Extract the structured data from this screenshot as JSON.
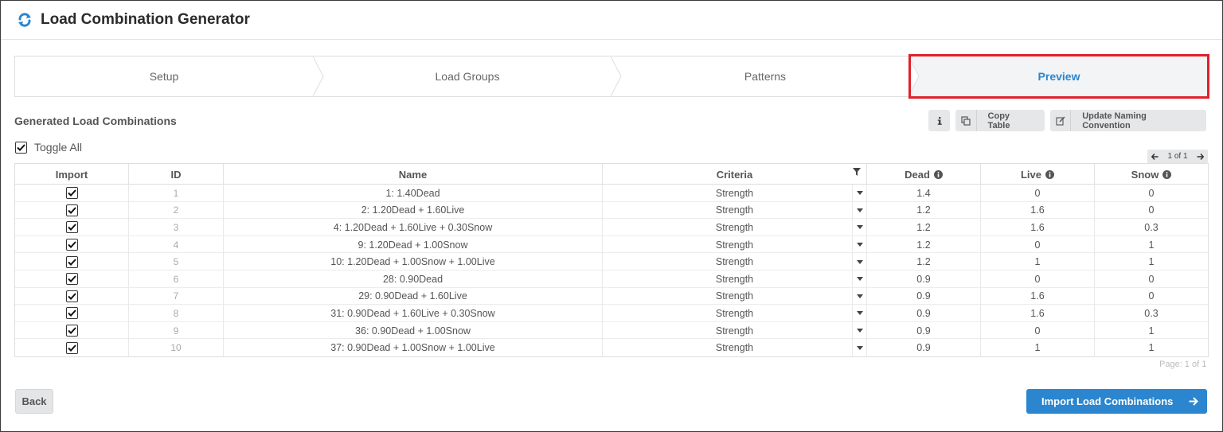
{
  "app": {
    "title": "Load Combination Generator"
  },
  "steps": [
    {
      "label": "Setup",
      "active": false
    },
    {
      "label": "Load Groups",
      "active": false
    },
    {
      "label": "Patterns",
      "active": false
    },
    {
      "label": "Preview",
      "active": true
    }
  ],
  "section": {
    "title": "Generated Load Combinations"
  },
  "toolbar": {
    "copy_label": "Copy Table",
    "naming_label": "Update Naming Convention"
  },
  "toggle_all": {
    "label": "Toggle All",
    "checked": true
  },
  "pager": {
    "text": "1 of 1"
  },
  "table": {
    "headers": {
      "import": "Import",
      "id": "ID",
      "name": "Name",
      "criteria": "Criteria",
      "dead": "Dead",
      "live": "Live",
      "snow": "Snow"
    },
    "rows": [
      {
        "checked": true,
        "id": "1",
        "name": "1: 1.40Dead",
        "criteria": "Strength",
        "dead": "1.4",
        "live": "0",
        "snow": "0"
      },
      {
        "checked": true,
        "id": "2",
        "name": "2: 1.20Dead + 1.60Live",
        "criteria": "Strength",
        "dead": "1.2",
        "live": "1.6",
        "snow": "0"
      },
      {
        "checked": true,
        "id": "3",
        "name": "4: 1.20Dead + 1.60Live + 0.30Snow",
        "criteria": "Strength",
        "dead": "1.2",
        "live": "1.6",
        "snow": "0.3"
      },
      {
        "checked": true,
        "id": "4",
        "name": "9: 1.20Dead + 1.00Snow",
        "criteria": "Strength",
        "dead": "1.2",
        "live": "0",
        "snow": "1"
      },
      {
        "checked": true,
        "id": "5",
        "name": "10: 1.20Dead + 1.00Snow + 1.00Live",
        "criteria": "Strength",
        "dead": "1.2",
        "live": "1",
        "snow": "1"
      },
      {
        "checked": true,
        "id": "6",
        "name": "28: 0.90Dead",
        "criteria": "Strength",
        "dead": "0.9",
        "live": "0",
        "snow": "0"
      },
      {
        "checked": true,
        "id": "7",
        "name": "29: 0.90Dead + 1.60Live",
        "criteria": "Strength",
        "dead": "0.9",
        "live": "1.6",
        "snow": "0"
      },
      {
        "checked": true,
        "id": "8",
        "name": "31: 0.90Dead + 1.60Live + 0.30Snow",
        "criteria": "Strength",
        "dead": "0.9",
        "live": "1.6",
        "snow": "0.3"
      },
      {
        "checked": true,
        "id": "9",
        "name": "36: 0.90Dead + 1.00Snow",
        "criteria": "Strength",
        "dead": "0.9",
        "live": "0",
        "snow": "1"
      },
      {
        "checked": true,
        "id": "10",
        "name": "37: 0.90Dead + 1.00Snow + 1.00Live",
        "criteria": "Strength",
        "dead": "0.9",
        "live": "1",
        "snow": "1"
      }
    ]
  },
  "footer": {
    "page_text": "Page: 1 of 1",
    "back_label": "Back",
    "import_label": "Import Load Combinations"
  },
  "colors": {
    "accent": "#2b86cf",
    "highlight": "#e0202a"
  }
}
